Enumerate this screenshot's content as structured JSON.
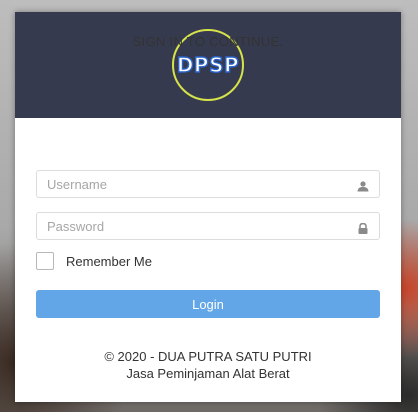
{
  "logo": {
    "text": "DPSP"
  },
  "form": {
    "title": "SIGN IN TO CONTINUE.",
    "username_placeholder": "Username",
    "password_placeholder": "Password",
    "remember_label": "Remember Me",
    "login_label": "Login"
  },
  "footer": {
    "line1": "©  2020 -   DUA PUTRA SATU PUTRI",
    "line2": "Jasa Peminjaman Alat Berat"
  },
  "icons": {
    "username": "user-icon",
    "password": "lock-icon"
  },
  "colors": {
    "header_bg": "#363a4f",
    "logo_ring": "#d6e34a",
    "logo_text": "#2a63c9",
    "button_bg": "#62a6e8"
  }
}
